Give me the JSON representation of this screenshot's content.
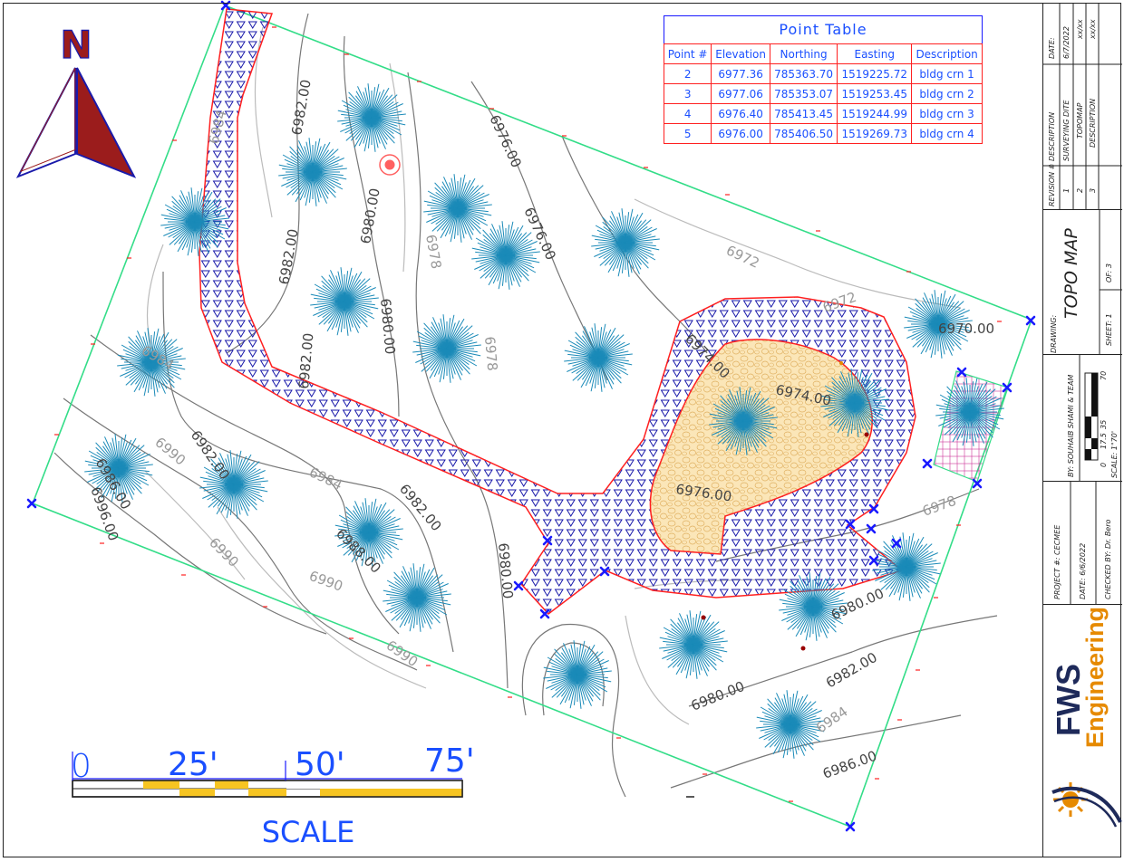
{
  "north_label": "N",
  "point_table": {
    "title": "Point Table",
    "headers": [
      "Point #",
      "Elevation",
      "Northing",
      "Easting",
      "Description"
    ],
    "rows": [
      [
        "2",
        "6977.36",
        "785363.70",
        "1519225.72",
        "bldg crn 1"
      ],
      [
        "3",
        "6977.06",
        "785353.07",
        "1519253.45",
        "bldg crn 2"
      ],
      [
        "4",
        "6976.40",
        "785413.45",
        "1519244.99",
        "bldg crn 3"
      ],
      [
        "5",
        "6976.00",
        "785406.50",
        "1519269.73",
        "bldg crn 4"
      ]
    ]
  },
  "contour_labels": {
    "c6982_a": "6982.00",
    "c6980_a": "6980.00",
    "c6976_a": "6976.00",
    "c6976_b": "6976.00",
    "c6984_a": "6984",
    "c6982_b": "6982.00",
    "c6982_c": "6982.00",
    "c6980_b": "6980.00",
    "c6978_a": "6978",
    "c6978_b": "6978",
    "c6974_a": "6974.00",
    "c6974_b": "6974.00",
    "c6976_c": "6976.00",
    "c6972_a": "6972",
    "c6972_b": "6972",
    "c6970": "6970.00",
    "c6984_b": "6984",
    "c6982_d": "6982.00",
    "c6982_e": "6982.00",
    "c6980_c": "6980.00",
    "c6984_c": "6984",
    "c6990_a": "6990",
    "c6990_b": "6990",
    "c6990_c": "6990",
    "c6990_d": "6990",
    "c6988": "6988.00",
    "c6986_a": "6986.00",
    "c6986_b": "6986.00",
    "c6980_d": "6980.00",
    "c6982_f": "6982.00",
    "c6980_e": "6980.00",
    "c6978_c": "6978",
    "c6984_d": "6984",
    "c6996": "6996.00"
  },
  "scale_bar": {
    "tick_labels": [
      "0",
      "25'",
      "50'",
      "75'"
    ],
    "caption": "SCALE",
    "colors": {
      "fill": "#f7c522",
      "outline": "#1a1aff"
    }
  },
  "title_block": {
    "revisions": {
      "header": {
        "rev": "REVISION #",
        "desc": "DESCRIPTION",
        "date": "DATE:"
      },
      "rows": [
        {
          "rev": "1",
          "desc": "SURVEYING DITE",
          "date": "6/7/2022"
        },
        {
          "rev": "2",
          "desc": "TOPOMAP",
          "date": "xx/xx"
        },
        {
          "rev": "3",
          "desc": "DESCRIPTION",
          "date": "xx/xx"
        }
      ]
    },
    "drawing_label": "DRAWING:",
    "drawing_title": "TOPO MAP",
    "sheet": "SHEET: 1",
    "of": "OF: 3",
    "by": "BY: SOUHAIB SHAMI & TEAM",
    "scale_label": "SCALE: 1\"70'",
    "scale_ticks": [
      "0",
      "17.5",
      "35",
      "70"
    ],
    "project": "PROJECT #: CECMEE",
    "date": "DATE: 6/6/2022",
    "checked_by": "CHECKED BY: Dr. Bero",
    "logo_text_1": "FWS",
    "logo_text_2": "Engineering"
  },
  "colors": {
    "boundary": "#33dd88",
    "building_outline": "#ff2020",
    "hatch": "#1a1aaa",
    "tree": "#1a8ab8",
    "pavement": "#fbe6b8",
    "compass_fill": "#9b1c1c",
    "compass_outline": "#1a1aaa",
    "table_text": "#1a4fff",
    "marker": "#1a1aff",
    "logo_orange": "#e68a00",
    "logo_navy": "#1e2a5a"
  }
}
